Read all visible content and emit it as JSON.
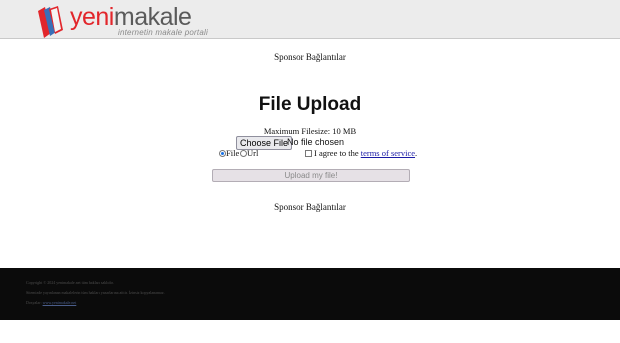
{
  "header": {
    "logo_part1": "yeni",
    "logo_part2": "makale",
    "tagline": "internetin makale portali"
  },
  "sponsor_top": "Sponsor Bağlantılar",
  "sponsor_bottom": "Sponsor Bağlantılar",
  "upload_form": {
    "title": "File Upload",
    "max_filesize": "Maximum Filesize: 10 MB",
    "choose_file_label": "Choose File",
    "no_file_text": "No file chosen",
    "mode_file_label": "File",
    "mode_url_label": "Url",
    "agree_prefix": "I agree to the",
    "terms_link": "terms of service",
    "agree_suffix": ".",
    "upload_button": "Upload my file!",
    "selected_mode": "File",
    "agree_checked": false
  },
  "footer": {
    "line1": "Copyright © 2024 yenimakale.net tüm hakları saklıdır.",
    "line2": "Sitemizde yayınlanan makalelerin tüm hakları yazarlarına aittir. İzinsiz kopyalanamaz.",
    "line3_prefix": "Dosyalar:",
    "line3_link": "www.yenimakale.net"
  },
  "colors": {
    "logo_red": "#e2262b",
    "logo_gray": "#5a5a5a",
    "header_bg": "#ececec",
    "footer_bg": "#0b0b0b",
    "link": "#1a1aa6"
  }
}
